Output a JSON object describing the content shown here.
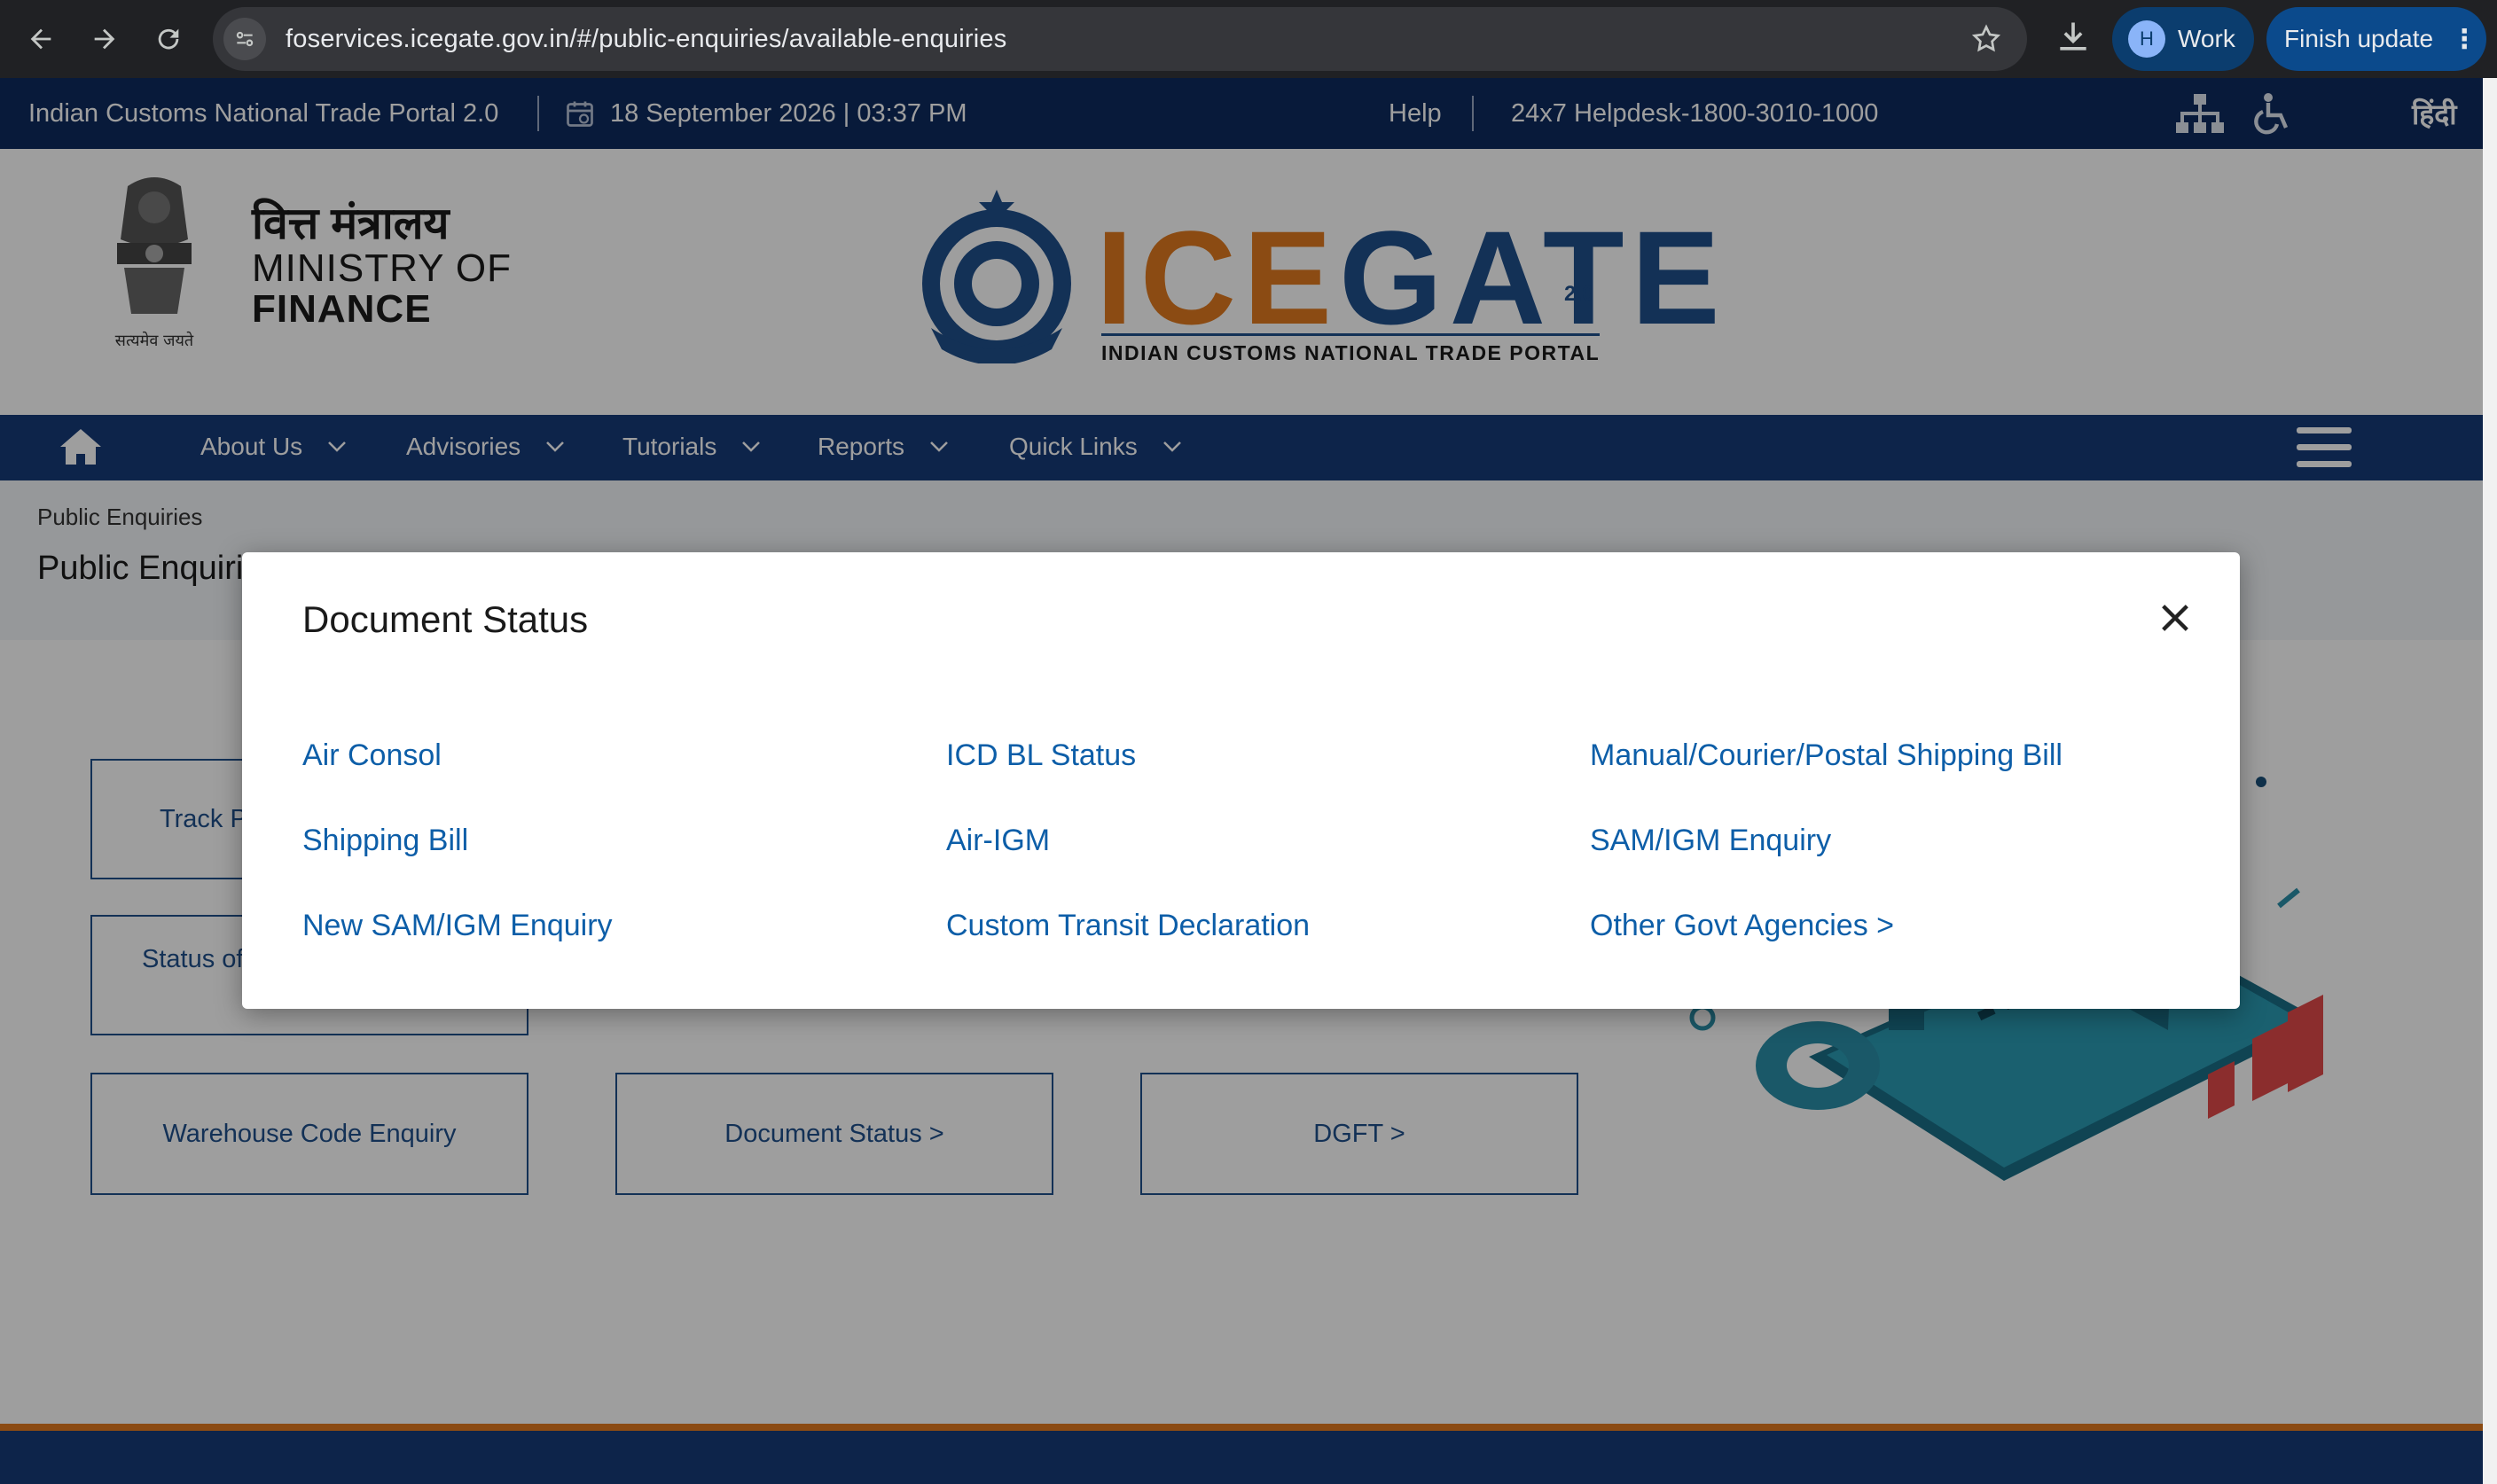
{
  "browser": {
    "url": "foservices.icegate.gov.in/#/public-enquiries/available-enquiries",
    "profile_initial": "H",
    "profile_label": "Work",
    "update_label": "Finish update"
  },
  "topbar": {
    "portal_name": "Indian Customs National Trade Portal 2.0",
    "datetime": "18 September 2026 | 03:37 PM",
    "help": "Help",
    "helpdesk": "24x7 Helpdesk-1800-3010-1000",
    "language": "हिंदी"
  },
  "header": {
    "ministry_hindi": "वित्त मंत्रालय",
    "ministry_line1": "MINISTRY OF",
    "ministry_line2": "FINANCE",
    "emblem_caption": "सत्यमेव जयते",
    "logo_ic": "ICE",
    "logo_gate": "GATE",
    "logo_version": "2.0",
    "logo_subtitle": "INDIAN CUSTOMS NATIONAL TRADE PORTAL"
  },
  "nav": {
    "items": [
      {
        "label": "About Us"
      },
      {
        "label": "Advisories"
      },
      {
        "label": "Tutorials"
      },
      {
        "label": "Reports"
      },
      {
        "label": "Quick Links"
      }
    ]
  },
  "breadcrumb": "Public Enquiries",
  "page_title": "Public Enquiri",
  "enquiry_buttons": {
    "track": "Track P",
    "status_of": "Status of",
    "warehouse": "Warehouse Code Enquiry",
    "document_status": "Document Status >",
    "dgft": "DGFT >"
  },
  "modal": {
    "title": "Document Status",
    "links": [
      "Air Consol",
      "ICD BL Status",
      "Manual/Courier/Postal Shipping Bill",
      "Shipping Bill",
      "Air-IGM",
      "SAM/IGM Enquiry",
      "New SAM/IGM Enquiry",
      "Custom Transit Declaration",
      "Other Govt Agencies >"
    ]
  },
  "colors": {
    "navy": "#0d2a5e",
    "nav_blue": "#163a78",
    "link_blue": "#0d5ea8",
    "orange": "#e07a1f"
  }
}
